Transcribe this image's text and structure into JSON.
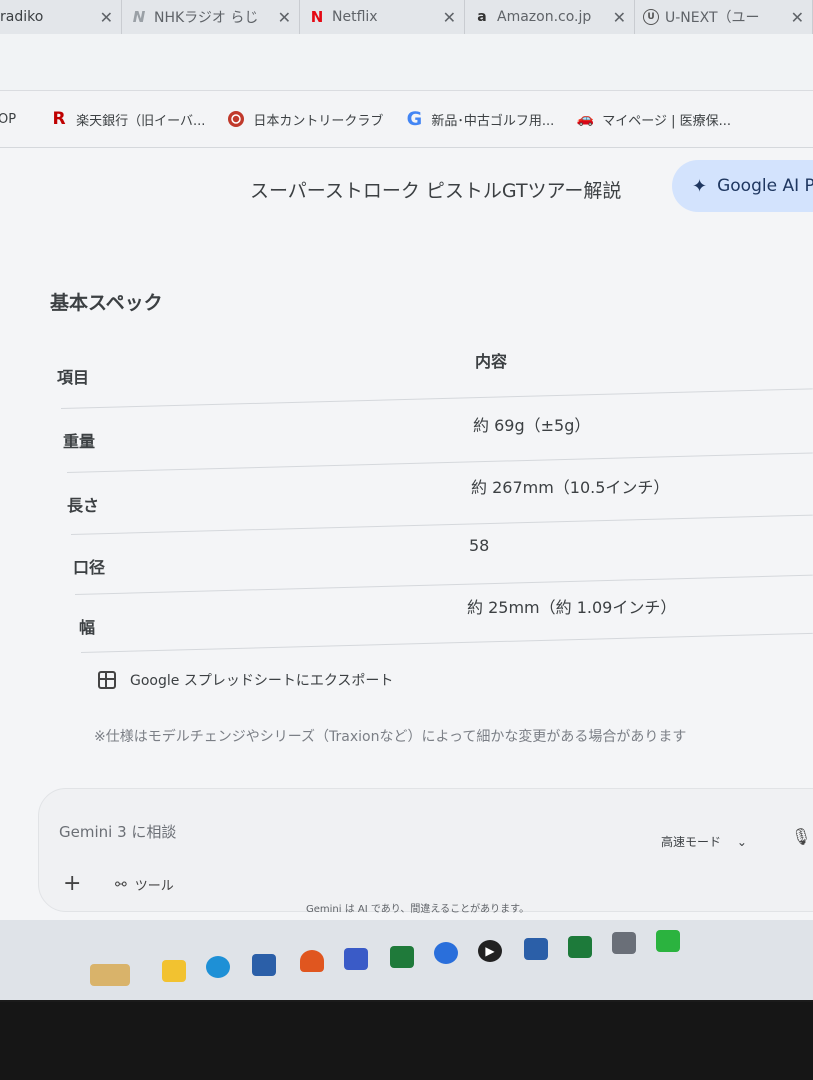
{
  "tabs": [
    {
      "label": "radiko",
      "icon": "radiko-icon"
    },
    {
      "label": "NHKラジオ らじ",
      "icon": "nhk-icon"
    },
    {
      "label": "Netflix",
      "icon": "netflix-icon"
    },
    {
      "label": "Amazon.co.jp",
      "icon": "amazon-icon"
    },
    {
      "label": "U-NEXT（ユー",
      "icon": "unext-icon"
    }
  ],
  "bookmarks": [
    {
      "label": "OP",
      "icon": ""
    },
    {
      "label": "楽天銀行（旧イーバ...",
      "icon": "rakuten-icon"
    },
    {
      "label": "日本カントリークラブ",
      "icon": "country-club-icon"
    },
    {
      "label": "新品･中古ゴルフ用...",
      "icon": "google-icon"
    },
    {
      "label": "マイページ | 医療保...",
      "icon": "car-icon"
    }
  ],
  "page": {
    "title": "スーパーストローク ピストルGTツアー解説",
    "ai_button": "Google AI P",
    "section_title": "基本スペック",
    "table": {
      "headers": [
        "項目",
        "内容"
      ],
      "rows": [
        {
          "key": "重量",
          "value": "約 69g（±5g）"
        },
        {
          "key": "長さ",
          "value": "約 267mm（10.5インチ）"
        },
        {
          "key": "口径",
          "value": "58"
        },
        {
          "key": "幅",
          "value": "約 25mm（約 1.09インチ）"
        }
      ]
    },
    "export_label": "Google スプレッドシートにエクスポート",
    "note": "※仕様はモデルチェンジやシリーズ（Traxionなど）によって細かな変更がある場合があります"
  },
  "composer": {
    "placeholder": "Gemini 3 に相談",
    "tools_label": "ツール",
    "mode_label": "高速モード",
    "disclaimer": "Gemini は AI であり、間違えることがあります。"
  },
  "colors": {
    "ai_button_bg": "#d3e3fd",
    "page_bg": "#f4f5f7",
    "rakuten_red": "#bf0000",
    "netflix_red": "#e50914"
  }
}
